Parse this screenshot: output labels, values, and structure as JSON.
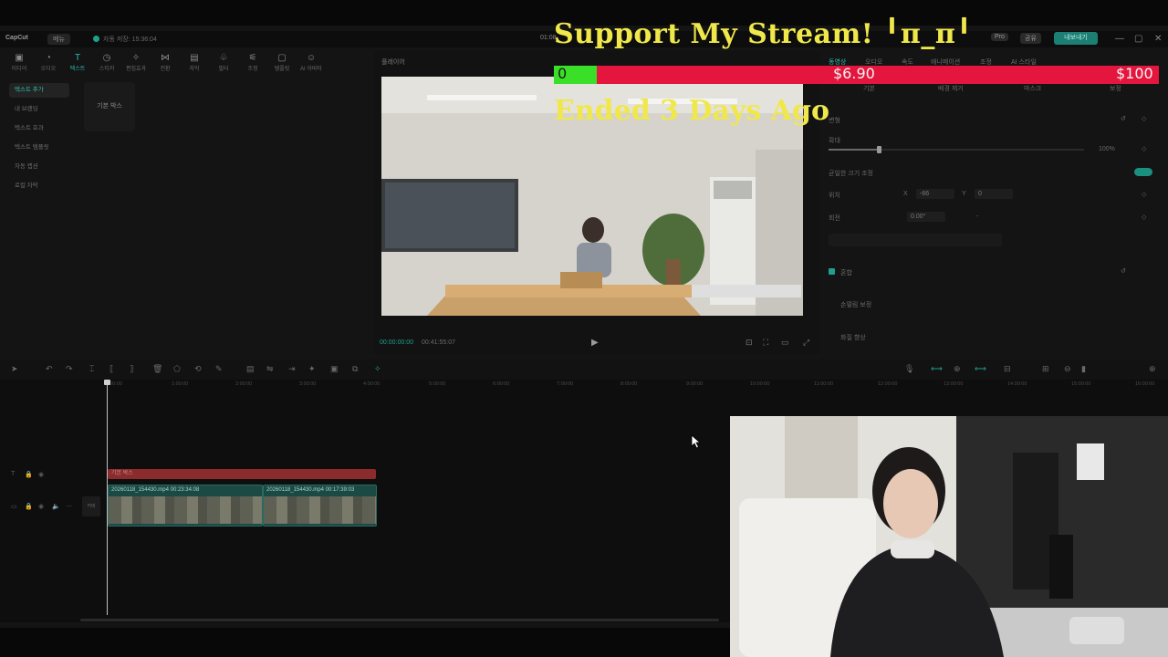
{
  "app": {
    "logo": "CapCut",
    "menu_label": "메뉴",
    "status_text": "자동 저장: 15:36:04",
    "project_title": "01:08",
    "pro_label": "Pro",
    "share_label": "공유",
    "export_label": "내보내기"
  },
  "tools": [
    {
      "icon": "media-icon",
      "label": "미디어"
    },
    {
      "icon": "audio-icon",
      "label": "오디오"
    },
    {
      "icon": "text-icon",
      "label": "텍스트"
    },
    {
      "icon": "sticker-icon",
      "label": "스티커"
    },
    {
      "icon": "effects-icon",
      "label": "편집효과"
    },
    {
      "icon": "transition-icon",
      "label": "전환"
    },
    {
      "icon": "captions-icon",
      "label": "자막"
    },
    {
      "icon": "filter-icon",
      "label": "필터"
    },
    {
      "icon": "adjust-icon",
      "label": "조정"
    },
    {
      "icon": "template-icon",
      "label": "템플릿"
    },
    {
      "icon": "ai-icon",
      "label": "AI 아바타"
    }
  ],
  "side_menu": [
    {
      "label": "텍스트 추가"
    },
    {
      "label": "내 브랜딩"
    },
    {
      "label": "텍스트 효과"
    },
    {
      "label": "텍스트 템플릿"
    },
    {
      "label": "자동 캡션"
    },
    {
      "label": "로컬 자막"
    }
  ],
  "basic_box": "기본 박스",
  "player": {
    "label": "플레이어",
    "time_current": "00:00:00:00",
    "time_total": "00:41:55:07"
  },
  "props": {
    "tabs": [
      "동영상",
      "오디오",
      "속도",
      "애니메이션",
      "조정",
      "AI 스타일"
    ],
    "subtabs": [
      "기본",
      "배경 제거",
      "마스크",
      "보정"
    ],
    "transform_label": "변형",
    "scale_label": "확대",
    "scale_value": "100%",
    "uniform_label": "균일한 크기 조정",
    "position_label": "위치",
    "pos_x_label": "X",
    "pos_x": "-66",
    "pos_y_label": "Y",
    "pos_y": "0",
    "rotate_label": "회전",
    "rotate_value": "0.00°",
    "rotate_dash": "-",
    "blend_label": "혼합",
    "stabilize_label": "손떨림 보정",
    "enhance_label": "화질 향상"
  },
  "timeline": {
    "ruler": [
      "00:00",
      "1:00:00",
      "2:00:00",
      "3:00:00",
      "4:00:00",
      "5:00:00",
      "6:00:00",
      "7:00:00",
      "8:00:00",
      "9:00:00",
      "10:00:00",
      "11:00:00",
      "12:00:00",
      "13:00:00",
      "14:00:00",
      "15:00:00",
      "16:00:00",
      "17:00:00"
    ],
    "text_clip": "기본 박스",
    "clips": [
      {
        "label": "20260118_154430.mp4  00:23:34:08"
      },
      {
        "label": "20260118_154430.mp4  00:17:39:03"
      }
    ],
    "cover_label": "커버"
  },
  "overlay": {
    "title": "Support My Stream! ╹π_π╹",
    "goal_start": "0",
    "goal_current": "$6.90",
    "goal_target": "$100",
    "goal_progress": 0.069,
    "status": "Ended 3 Days Ago"
  },
  "colors": {
    "accent": "#2dbfad",
    "overlay_text": "#f0e84a",
    "goal_bar": "#e4163e",
    "goal_fill": "#39e027"
  }
}
